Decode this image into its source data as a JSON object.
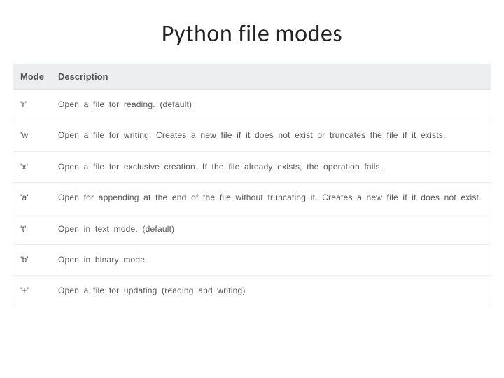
{
  "title": "Python file modes",
  "table": {
    "headers": {
      "mode": "Mode",
      "description": "Description"
    },
    "rows": [
      {
        "mode": "'r'",
        "description": "Open a file for reading. (default)"
      },
      {
        "mode": "'w'",
        "description": "Open a file for writing. Creates a new file if it does not exist or truncates the file if it exists."
      },
      {
        "mode": "'x'",
        "description": "Open a file for exclusive creation. If the file already exists, the operation fails."
      },
      {
        "mode": "'a'",
        "description": "Open for appending at the end of the file without truncating it. Creates a new file if it does not exist."
      },
      {
        "mode": "'t'",
        "description": "Open in text mode. (default)"
      },
      {
        "mode": "'b'",
        "description": "Open in binary mode."
      },
      {
        "mode": "'+'",
        "description": "Open a file for updating (reading and writing)"
      }
    ]
  }
}
